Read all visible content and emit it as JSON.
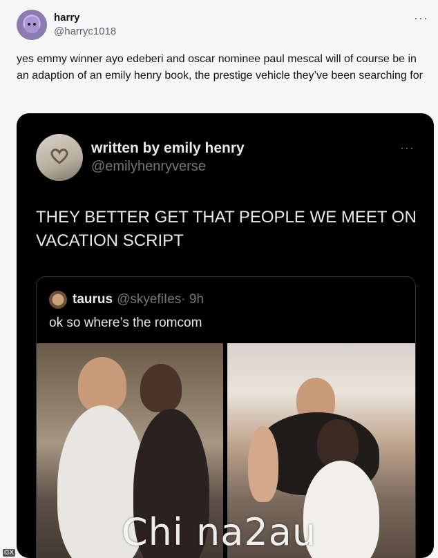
{
  "author": {
    "display_name": "harry",
    "handle": "@harryc1018",
    "avatar_icon": "avatar-icon"
  },
  "tweet": {
    "text": "yes emmy winner ayo edeberi and oscar nominee paul mescal will of course be in an adaption of an emily henry book, the prestige vehicle they’ve been searching for"
  },
  "more_label": "···",
  "embedded": {
    "display_name": "written by emily henry",
    "handle": "@emilyhenryverse",
    "more_label": "···",
    "text": "THEY BETTER GET THAT PEOPLE WE MEET ON VACATION SCRIPT",
    "quoted": {
      "display_name": "taurus",
      "handle": "@skyefiIes",
      "time": "· 9h",
      "text": "ok so where’s the romcom"
    }
  },
  "watermark": "Chi na2au",
  "corner_logo": "©X",
  "colors": {
    "background": "#f7f7f7",
    "embed_background": "#000000",
    "text_dark": "#0f1419",
    "text_muted": "#536471"
  }
}
